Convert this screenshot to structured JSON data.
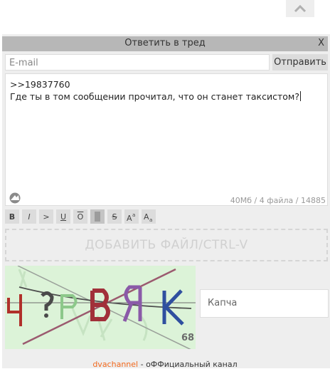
{
  "title_bar": {
    "title": "Ответить в тред",
    "close": "X"
  },
  "form": {
    "email_placeholder": "E-mail",
    "submit_label": "Отправить",
    "message_line1": ">>19837760",
    "message_line2": "Где ты в том сообщении прочитал, что он станет таксистом?",
    "limits": "40Мб / 4 файла / 14885"
  },
  "toolbar": {
    "bold": "B",
    "italic": "I",
    "quote": ">",
    "underline": "U",
    "overline": "O",
    "strike": "S"
  },
  "dropzone_label": "ДОБАВИТЬ ФАЙЛ/CTRL-V",
  "captcha": {
    "placeholder": "Капча",
    "number": "68"
  },
  "footer": {
    "link": "dvachannel",
    "sep": " - ",
    "text": "оФФициальный канал"
  },
  "icons": {
    "scroll_up": "chevron-up-icon",
    "sage": "sage-icon"
  }
}
